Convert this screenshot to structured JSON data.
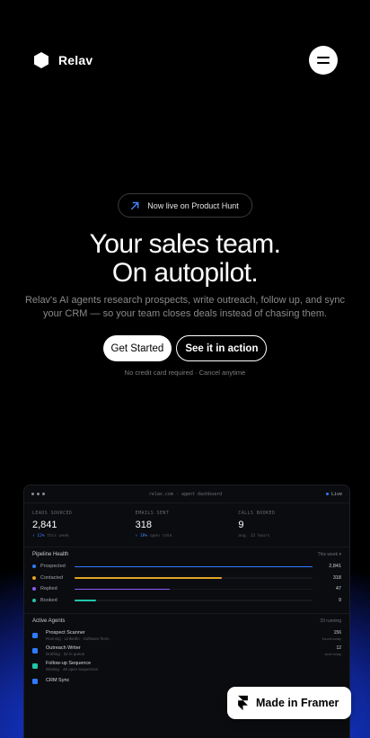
{
  "nav": {
    "brand": "Relav",
    "menu_icon": "hamburger-icon"
  },
  "hero": {
    "badge_text": "Now live on Product Hunt",
    "badge_icon": "arrow-up-right-icon",
    "title_line1": "Your sales team.",
    "title_line2": "On autopilot.",
    "subtitle": "Relav's AI agents research prospects, write outreach, follow up, and sync your CRM — so your team closes deals instead of chasing them.",
    "cta_primary": "Get Started",
    "cta_secondary": "See it in action",
    "note": "No credit card required · Cancel anytime"
  },
  "dashboard": {
    "breadcrumb": "relav.com · agent dashboard",
    "status": "Live",
    "stats": [
      {
        "label": "LEADS SOURCED",
        "value": "2,841",
        "delta": "↑ 12%",
        "note": "this week"
      },
      {
        "label": "EMAILS SENT",
        "value": "318",
        "delta": "↑ 18%",
        "note": "open rate"
      },
      {
        "label": "CALLS BOOKED",
        "value": "9",
        "delta": "",
        "note": "avg. 32 hours"
      }
    ],
    "pipeline": {
      "title": "Pipeline Health",
      "filter": "This week ▾",
      "rows": [
        {
          "label": "Prospected",
          "value": "2,841",
          "fraction": 1.0,
          "color": "#2f7bff"
        },
        {
          "label": "Contacted",
          "value": "318",
          "fraction": 0.62,
          "color": "#e0a526"
        },
        {
          "label": "Replied",
          "value": "47",
          "fraction": 0.4,
          "color": "#8b5cf6"
        },
        {
          "label": "Booked",
          "value": "9",
          "fraction": 0.09,
          "color": "#22c5a8"
        }
      ]
    },
    "agents": {
      "title": "Active Agents",
      "count": "33 running",
      "items": [
        {
          "name": "Prospect Scanner",
          "desc": "Running · LinkedIn · Software firms",
          "num": "156",
          "cap": "found today",
          "color": "#2f7bff"
        },
        {
          "name": "Outreach Writer",
          "desc": "Drafting · 32 in queue",
          "num": "12",
          "cap": "sent today",
          "color": "#2f7bff"
        },
        {
          "name": "Follow-up Sequence",
          "desc": "Waiting · 48 open sequences",
          "num": "",
          "cap": "",
          "color": "#22c5a8"
        },
        {
          "name": "CRM Sync",
          "desc": "",
          "num": "",
          "cap": "",
          "color": "#2f7bff"
        }
      ]
    }
  },
  "framer_badge": {
    "label": "Made in Framer",
    "icon": "framer-logo-icon"
  }
}
